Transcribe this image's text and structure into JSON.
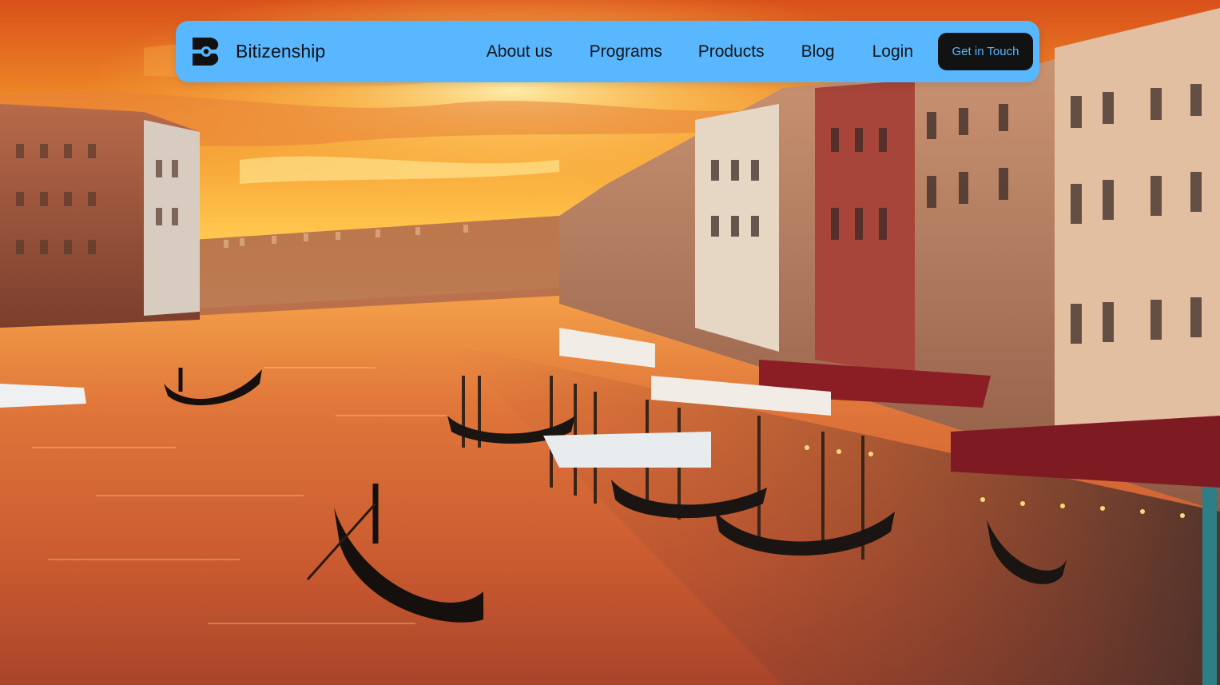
{
  "brand": {
    "name": "Bitizenship",
    "logo_icon": "bitizenship-logo-icon"
  },
  "nav": {
    "items": [
      {
        "label": "About us"
      },
      {
        "label": "Programs"
      },
      {
        "label": "Products"
      },
      {
        "label": "Blog"
      },
      {
        "label": "Login"
      }
    ],
    "cta_label": "Get in Touch"
  },
  "colors": {
    "navbar_background": "#58b7ff",
    "cta_background": "#121212",
    "cta_text": "#58b7ff",
    "nav_text": "#12161c"
  },
  "hero": {
    "image_subject": "venice-grand-canal-sunset-photo"
  }
}
